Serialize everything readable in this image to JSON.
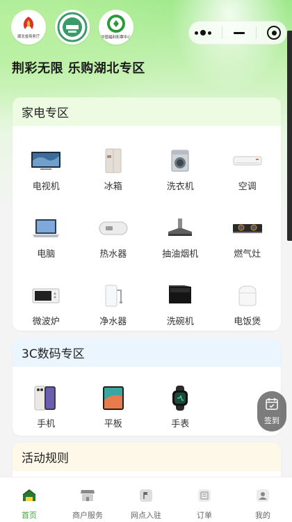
{
  "header": {
    "logos": [
      {
        "icon": "hubei-commerce-logo",
        "caption": "湖北省商务厅"
      },
      {
        "icon": "green-badge-logo",
        "caption": ""
      },
      {
        "icon": "china-welfare-lottery-logo",
        "caption": "中国福利彩票中心"
      }
    ],
    "slogan": "荆彩无限 乐购湖北专区"
  },
  "appliance_section": {
    "title": "家电专区",
    "head_color": "#edfbe3",
    "items": [
      {
        "label": "电视机",
        "icon": "tv-icon"
      },
      {
        "label": "冰箱",
        "icon": "fridge-icon"
      },
      {
        "label": "洗衣机",
        "icon": "washer-icon"
      },
      {
        "label": "空调",
        "icon": "ac-icon"
      },
      {
        "label": "电脑",
        "icon": "laptop-icon"
      },
      {
        "label": "热水器",
        "icon": "water-heater-icon"
      },
      {
        "label": "抽油烟机",
        "icon": "range-hood-icon"
      },
      {
        "label": "燃气灶",
        "icon": "gas-stove-icon"
      },
      {
        "label": "微波炉",
        "icon": "microwave-icon"
      },
      {
        "label": "净水器",
        "icon": "water-purifier-icon"
      },
      {
        "label": "洗碗机",
        "icon": "dishwasher-icon"
      },
      {
        "label": "电饭煲",
        "icon": "rice-cooker-icon"
      }
    ]
  },
  "digital_section": {
    "title": "3C数码专区",
    "head_color": "#eaf5fd",
    "items": [
      {
        "label": "手机",
        "icon": "phone-icon"
      },
      {
        "label": "平板",
        "icon": "tablet-icon"
      },
      {
        "label": "手表",
        "icon": "watch-icon"
      }
    ]
  },
  "rules_section": {
    "title": "活动规则",
    "head_color": "#fdf8e8"
  },
  "floating_button": {
    "label": "签到",
    "icon": "calendar-check-icon"
  },
  "tabbar": {
    "active_color": "#3aa83a",
    "tabs": [
      {
        "label": "首页",
        "icon": "home-icon",
        "active": true
      },
      {
        "label": "商户服务",
        "icon": "shop-icon",
        "active": false
      },
      {
        "label": "网点入驻",
        "icon": "flag-icon",
        "active": false
      },
      {
        "label": "订单",
        "icon": "order-icon",
        "active": false
      },
      {
        "label": "我的",
        "icon": "user-icon",
        "active": false
      }
    ]
  }
}
